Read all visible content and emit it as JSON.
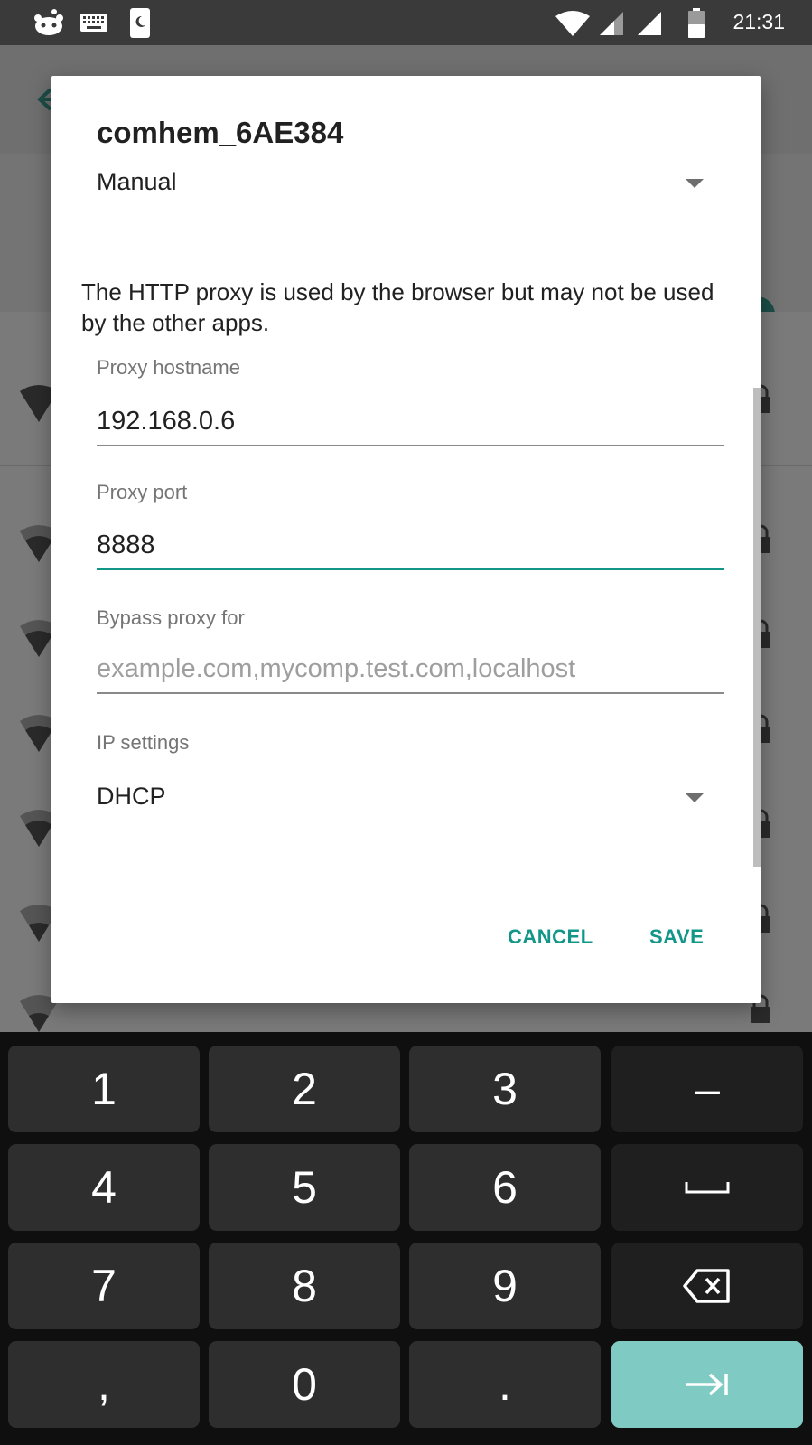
{
  "status_bar": {
    "time": "21:31",
    "icons": [
      "reddit-icon",
      "keyboard-icon",
      "phone-icon",
      "wifi-icon",
      "signal-icon",
      "signal-icon",
      "battery-icon"
    ]
  },
  "dialog": {
    "title": "comhem_6AE384",
    "proxy_mode": "Manual",
    "info_text": "The HTTP proxy is used by the browser but may not be used by the other apps.",
    "proxy_hostname": {
      "label": "Proxy hostname",
      "value": "192.168.0.6"
    },
    "proxy_port": {
      "label": "Proxy port",
      "value": "8888"
    },
    "bypass_proxy": {
      "label": "Bypass proxy for",
      "placeholder": "example.com,mycomp.test.com,localhost"
    },
    "ip_settings": {
      "label": "IP settings",
      "value": "DHCP"
    },
    "cancel_label": "CANCEL",
    "save_label": "SAVE"
  },
  "keyboard": {
    "keys": [
      "1",
      "2",
      "3",
      "–",
      "4",
      "5",
      "6",
      "7",
      "8",
      "9",
      ",",
      "0",
      "."
    ],
    "special_icons": [
      "space-icon",
      "backspace-icon",
      "next-field-icon"
    ]
  },
  "colors": {
    "accent": "#129688",
    "enter_key": "#7fcbc3",
    "dim_background": "#7a7a7a",
    "keyboard_bg": "#0f0f0f",
    "key_bg": "#2e2e2e"
  }
}
